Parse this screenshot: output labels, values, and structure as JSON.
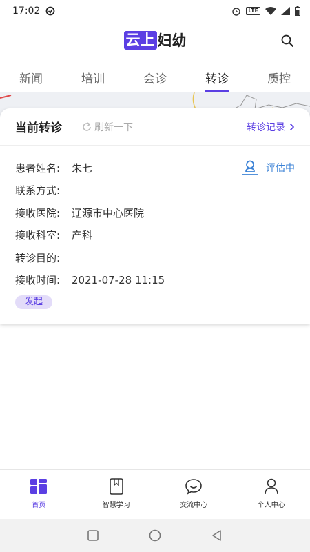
{
  "status_bar": {
    "time": "17:02",
    "network": "LTE"
  },
  "header": {
    "logo_box": "云上",
    "logo_rest": "妇幼"
  },
  "tabs": [
    {
      "label": "新闻"
    },
    {
      "label": "培训"
    },
    {
      "label": "会诊"
    },
    {
      "label": "转诊"
    },
    {
      "label": "质控"
    }
  ],
  "card": {
    "title": "当前转诊",
    "refresh_label": "刷新一下",
    "records_link": "转诊记录",
    "status": "评估中",
    "rows": [
      {
        "label": "患者姓名:",
        "value": "朱七"
      },
      {
        "label": "联系方式:",
        "value": ""
      },
      {
        "label": "接收医院:",
        "value": "辽源市中心医院"
      },
      {
        "label": "接收科室:",
        "value": "产科"
      },
      {
        "label": "转诊目的:",
        "value": ""
      },
      {
        "label": "接收时间:",
        "value": "2021-07-28 11:15"
      }
    ],
    "tag": "发起"
  },
  "bottom_nav": [
    {
      "label": "首页",
      "icon": "home-grid-icon"
    },
    {
      "label": "智慧学习",
      "icon": "book-icon"
    },
    {
      "label": "交流中心",
      "icon": "chat-bubble-icon"
    },
    {
      "label": "个人中心",
      "icon": "person-icon"
    }
  ],
  "colors": {
    "accent": "#5b3fe3",
    "status_blue": "#3b82d6"
  }
}
